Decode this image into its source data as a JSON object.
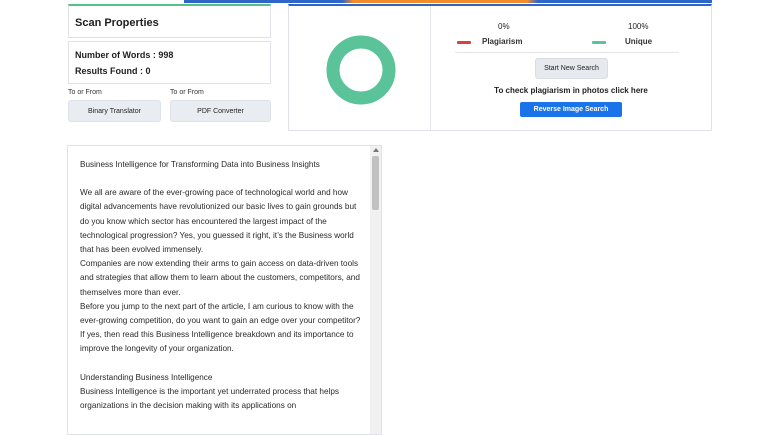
{
  "scan_properties": {
    "title": "Scan Properties",
    "words_label": "Number of Words : 998",
    "results_label": "Results Found : 0"
  },
  "tools": [
    {
      "caption": "To or From",
      "button": "Binary Translator"
    },
    {
      "caption": "To or From",
      "button": "PDF Converter"
    }
  ],
  "result": {
    "plagiarism_pct": "0%",
    "unique_pct": "100%",
    "plagiarism_label": "Plagiarism",
    "unique_label": "Unique",
    "plagiarism_fraction": 0.0,
    "unique_fraction": 1.0,
    "new_search_label": "Start New Search",
    "photo_hint": "To check plagiarism in photos click here",
    "reverse_search_label": "Reverse Image Search"
  },
  "colors": {
    "accent_green": "#55c08a",
    "plagiarism_red": "#d9413c",
    "unique_green": "#5ac39a",
    "primary_blue": "#1a73e8"
  },
  "document": {
    "paragraphs": [
      "Business Intelligence for Transforming Data into Business Insights",
      "",
      "We all are aware of the ever-growing pace of technological world and how digital advancements have revolutionized our basic lives to gain grounds but do you know which sector has encountered the largest impact of the technological progression? Yes, you guessed it right, it’s the Business world that has been evolved immensely.",
      "Companies are now extending their arms to gain access on data-driven tools and strategies that allow them to learn about the customers, competitors, and themselves more than ever.",
      "Before you jump to the next part of the article, I am curious to know with the ever-growing competition, do you want to gain an edge over your competitor?",
      "If yes, then read this Business Intelligence breakdown and its importance to improve the longevity of your organization.",
      "",
      "Understanding Business Intelligence",
      "Business Intelligence is the important yet underrated process that helps organizations in the decision making with its applications on"
    ]
  }
}
